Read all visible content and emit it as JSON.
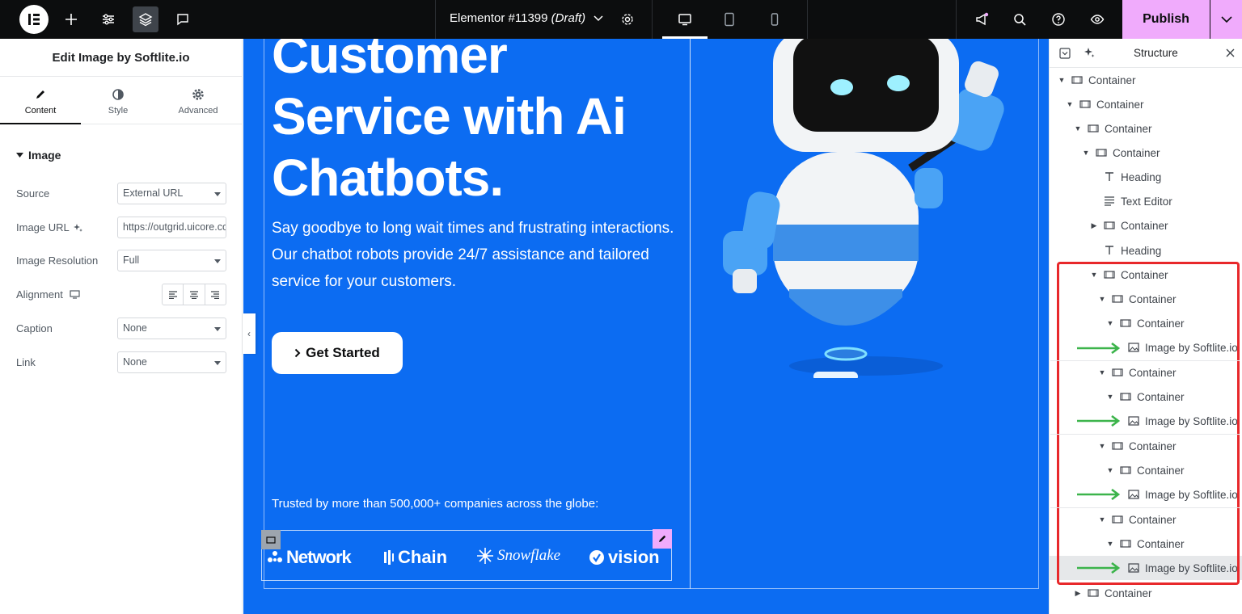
{
  "topbar": {
    "doc_name": "Elementor #11399",
    "doc_status": "(Draft)",
    "publish_label": "Publish"
  },
  "left_panel": {
    "title": "Edit Image by Softlite.io",
    "tabs": [
      "Content",
      "Style",
      "Advanced"
    ],
    "section_title": "Image",
    "controls": {
      "source_label": "Source",
      "source_value": "External URL",
      "url_label": "Image URL",
      "url_value": "https://outgrid.uicore.co",
      "resolution_label": "Image Resolution",
      "resolution_value": "Full",
      "alignment_label": "Alignment",
      "caption_label": "Caption",
      "caption_value": "None",
      "link_label": "Link",
      "link_value": "None"
    }
  },
  "canvas": {
    "heading": "Customer Service with Ai Chatbots.",
    "paragraph": "Say goodbye to long wait times and frustrating interactions. Our chatbot robots provide 24/7 assistance and tailored service for your customers.",
    "button_label": "Get Started",
    "trusted_text": "Trusted by more than 500,000+ companies across the globe:",
    "logos": [
      "Network",
      "Chain",
      "Snowflake",
      "vision"
    ],
    "bg_color": "#0c6cf2"
  },
  "structure": {
    "title": "Structure",
    "rows": [
      {
        "label": "Container",
        "type": "container",
        "toggle": "open"
      },
      {
        "label": "Container",
        "type": "container",
        "toggle": "open"
      },
      {
        "label": "Container",
        "type": "container",
        "toggle": "open"
      },
      {
        "label": "Container",
        "type": "container",
        "toggle": "open"
      },
      {
        "label": "Heading",
        "type": "heading",
        "toggle": "none"
      },
      {
        "label": "Text Editor",
        "type": "text",
        "toggle": "none"
      },
      {
        "label": "Container",
        "type": "container",
        "toggle": "closed"
      },
      {
        "label": "Heading",
        "type": "heading",
        "toggle": "none"
      },
      {
        "label": "Container",
        "type": "container",
        "toggle": "open"
      },
      {
        "label": "Container",
        "type": "container",
        "toggle": "open"
      },
      {
        "label": "Container",
        "type": "container",
        "toggle": "open"
      },
      {
        "label": "Image by Softlite.io",
        "type": "image",
        "toggle": "none"
      },
      {
        "label": "Container",
        "type": "container",
        "toggle": "open"
      },
      {
        "label": "Container",
        "type": "container",
        "toggle": "open"
      },
      {
        "label": "Image by Softlite.io",
        "type": "image",
        "toggle": "none"
      },
      {
        "label": "Container",
        "type": "container",
        "toggle": "open"
      },
      {
        "label": "Container",
        "type": "container",
        "toggle": "open"
      },
      {
        "label": "Image by Softlite.io",
        "type": "image",
        "toggle": "none"
      },
      {
        "label": "Container",
        "type": "container",
        "toggle": "open"
      },
      {
        "label": "Container",
        "type": "container",
        "toggle": "open"
      },
      {
        "label": "Image by Softlite.io",
        "type": "image",
        "toggle": "none",
        "selected": true
      },
      {
        "label": "Container",
        "type": "container",
        "toggle": "closed"
      }
    ]
  },
  "colors": {
    "accent": "#f0abfc",
    "highlight_box": "#e8282b",
    "arrow": "#3cb44b"
  }
}
